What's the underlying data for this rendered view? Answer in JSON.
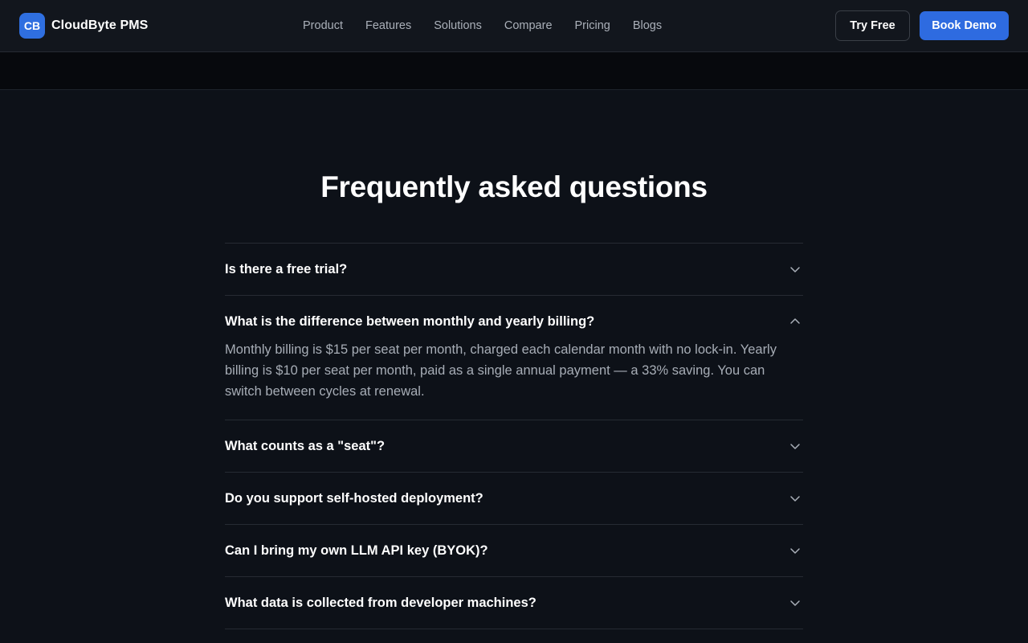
{
  "header": {
    "logo_text": "CB",
    "brand_name": "CloudByte PMS",
    "nav": [
      "Product",
      "Features",
      "Solutions",
      "Compare",
      "Pricing",
      "Blogs"
    ],
    "try_free": "Try Free",
    "book_demo": "Book Demo"
  },
  "faq": {
    "title": "Frequently asked questions",
    "items": [
      {
        "question": "Is there a free trial?",
        "expanded": false
      },
      {
        "question": "What is the difference between monthly and yearly billing?",
        "expanded": true,
        "answer": "Monthly billing is $15 per seat per month, charged each calendar month with no lock-in. Yearly billing is $10 per seat per month, paid as a single annual payment — a 33% saving. You can switch between cycles at renewal."
      },
      {
        "question": "What counts as a \"seat\"?",
        "expanded": false
      },
      {
        "question": "Do you support self-hosted deployment?",
        "expanded": false
      },
      {
        "question": "Can I bring my own LLM API key (BYOK)?",
        "expanded": false
      },
      {
        "question": "What data is collected from developer machines?",
        "expanded": false
      }
    ]
  },
  "colors": {
    "background": "#0d1118",
    "accent": "#2e6be0",
    "answer_text": "#a7adb6"
  },
  "icons": {
    "collapsed": "chevron-down-icon",
    "expanded": "chevron-up-icon"
  }
}
